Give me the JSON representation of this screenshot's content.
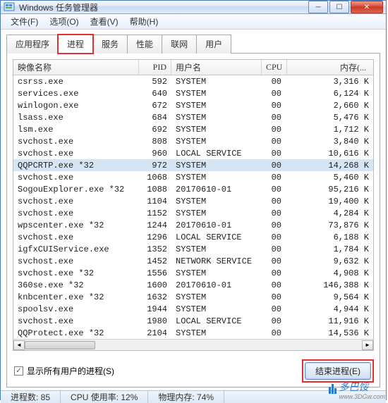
{
  "window": {
    "title": "Windows 任务管理器"
  },
  "menu": {
    "file": "文件(F)",
    "options": "选项(O)",
    "view": "查看(V)",
    "help": "帮助(H)"
  },
  "tabs": {
    "apps": "应用程序",
    "processes": "进程",
    "services": "服务",
    "performance": "性能",
    "networking": "联网",
    "users": "用户"
  },
  "columns": {
    "name": "映像名称",
    "pid": "PID",
    "user": "用户名",
    "cpu": "CPU",
    "mem": "内存(..."
  },
  "processes": [
    {
      "name": "csrss.exe",
      "pid": "592",
      "user": "SYSTEM",
      "cpu": "00",
      "mem": "3,316 K",
      "sel": false
    },
    {
      "name": "services.exe",
      "pid": "640",
      "user": "SYSTEM",
      "cpu": "00",
      "mem": "6,124 K",
      "sel": false
    },
    {
      "name": "winlogon.exe",
      "pid": "672",
      "user": "SYSTEM",
      "cpu": "00",
      "mem": "2,660 K",
      "sel": false
    },
    {
      "name": "lsass.exe",
      "pid": "684",
      "user": "SYSTEM",
      "cpu": "00",
      "mem": "5,476 K",
      "sel": false
    },
    {
      "name": "lsm.exe",
      "pid": "692",
      "user": "SYSTEM",
      "cpu": "00",
      "mem": "1,712 K",
      "sel": false
    },
    {
      "name": "svchost.exe",
      "pid": "808",
      "user": "SYSTEM",
      "cpu": "00",
      "mem": "3,840 K",
      "sel": false
    },
    {
      "name": "svchost.exe",
      "pid": "960",
      "user": "LOCAL SERVICE",
      "cpu": "00",
      "mem": "10,616 K",
      "sel": false
    },
    {
      "name": "QQPCRTP.exe *32",
      "pid": "972",
      "user": "SYSTEM",
      "cpu": "00",
      "mem": "14,268 K",
      "sel": true
    },
    {
      "name": "svchost.exe",
      "pid": "1068",
      "user": "SYSTEM",
      "cpu": "00",
      "mem": "5,460 K",
      "sel": false
    },
    {
      "name": "SogouExplorer.exe *32",
      "pid": "1088",
      "user": "20170610-01",
      "cpu": "00",
      "mem": "95,216 K",
      "sel": false
    },
    {
      "name": "svchost.exe",
      "pid": "1104",
      "user": "SYSTEM",
      "cpu": "00",
      "mem": "19,400 K",
      "sel": false
    },
    {
      "name": "svchost.exe",
      "pid": "1152",
      "user": "SYSTEM",
      "cpu": "00",
      "mem": "4,284 K",
      "sel": false
    },
    {
      "name": "wpscenter.exe *32",
      "pid": "1244",
      "user": "20170610-01",
      "cpu": "00",
      "mem": "73,876 K",
      "sel": false
    },
    {
      "name": "svchost.exe",
      "pid": "1296",
      "user": "LOCAL SERVICE",
      "cpu": "00",
      "mem": "6,188 K",
      "sel": false
    },
    {
      "name": "igfxCUIService.exe",
      "pid": "1352",
      "user": "SYSTEM",
      "cpu": "00",
      "mem": "1,784 K",
      "sel": false
    },
    {
      "name": "svchost.exe",
      "pid": "1452",
      "user": "NETWORK SERVICE",
      "cpu": "00",
      "mem": "9,632 K",
      "sel": false
    },
    {
      "name": "svchost.exe *32",
      "pid": "1556",
      "user": "SYSTEM",
      "cpu": "00",
      "mem": "4,908 K",
      "sel": false
    },
    {
      "name": "360se.exe *32",
      "pid": "1600",
      "user": "20170610-01",
      "cpu": "00",
      "mem": "146,388 K",
      "sel": false
    },
    {
      "name": "knbcenter.exe *32",
      "pid": "1632",
      "user": "SYSTEM",
      "cpu": "00",
      "mem": "9,564 K",
      "sel": false
    },
    {
      "name": "spoolsv.exe",
      "pid": "1944",
      "user": "SYSTEM",
      "cpu": "00",
      "mem": "4,944 K",
      "sel": false
    },
    {
      "name": "svchost.exe",
      "pid": "1980",
      "user": "LOCAL SERVICE",
      "cpu": "00",
      "mem": "11,916 K",
      "sel": false
    },
    {
      "name": "QQProtect.exe *32",
      "pid": "2104",
      "user": "SYSTEM",
      "cpu": "00",
      "mem": "14,536 K",
      "sel": false
    }
  ],
  "footer": {
    "show_all_label": "显示所有用户的进程(S)",
    "end_process_label": "结束进程(E)"
  },
  "status": {
    "proc_count_label": "进程数: 85",
    "cpu_label": "CPU 使用率: 12%",
    "mem_label": "物理内存: 74%"
  },
  "watermark": {
    "text": "多巴馁",
    "url": "www.3DGw.com"
  }
}
